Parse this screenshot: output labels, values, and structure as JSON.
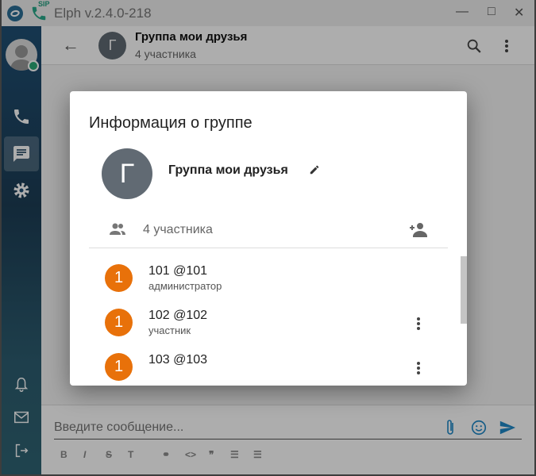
{
  "app": {
    "title": "Elph v.2.4.0-218",
    "sip_badge": "SIP"
  },
  "header": {
    "avatar_letter": "Г",
    "chat_name": "Группа мои друзья",
    "subtitle": "4 участника"
  },
  "composer": {
    "placeholder": "Введите сообщение...",
    "format_buttons": [
      "B",
      "I",
      "S",
      "T",
      "link",
      "<>",
      "quote",
      "bullets",
      "numbered"
    ]
  },
  "dialog": {
    "title": "Информация о группе",
    "avatar_letter": "Г",
    "group_name": "Группа мои друзья",
    "members_count": "4 участника",
    "members": [
      {
        "avatar": "1",
        "name": "101 @101",
        "role": "администратор"
      },
      {
        "avatar": "1",
        "name": "102 @102",
        "role": "участник"
      },
      {
        "avatar": "1",
        "name": "103 @103",
        "role": ""
      }
    ]
  },
  "colors": {
    "accent": "#1e88c8",
    "member_avatar": "#e8710a",
    "group_avatar": "#616a73",
    "sidebar": "#1f4f74"
  }
}
